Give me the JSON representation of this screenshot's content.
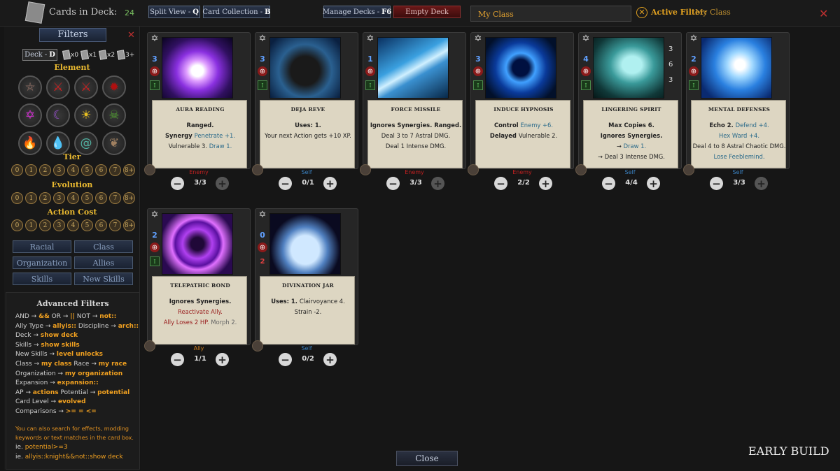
{
  "header": {
    "cards_in_deck_label": "Cards in Deck:",
    "cards_in_deck_count": "24",
    "split_view": {
      "label": "Split View -",
      "key": "Q"
    },
    "card_collection": {
      "label": "Card Collection -",
      "key": "B"
    },
    "manage_decks": {
      "label": "Manage Decks -",
      "key": "F6"
    },
    "empty_deck": "Empty Deck",
    "search_value": "My Class",
    "active_filter_label": "Active Filter:",
    "active_filter_value": "My Class"
  },
  "sidebar": {
    "filters_title": "Filters",
    "deck_button": {
      "label": "Deck -",
      "key": "D"
    },
    "copies": [
      "x0",
      "x1",
      "x2",
      "3+"
    ],
    "element_title": "Element",
    "elements": [
      {
        "icon": "pentagram-icon",
        "color": "#8a6a60"
      },
      {
        "icon": "crossed-swords-icon",
        "color": "#cc2020"
      },
      {
        "icon": "crossed-swords-blood-icon",
        "color": "#cc2020"
      },
      {
        "icon": "blood-splat-icon",
        "color": "#b01010"
      },
      {
        "icon": "hexagram-icon",
        "color": "#d030d0"
      },
      {
        "icon": "crescent-moon-icon",
        "color": "#9a50d0"
      },
      {
        "icon": "sun-icon",
        "color": "#e8c020"
      },
      {
        "icon": "skull-icon",
        "color": "#50a030"
      },
      {
        "icon": "flame-icon",
        "color": "#e06010"
      },
      {
        "icon": "water-drop-icon",
        "color": "#2060d0"
      },
      {
        "icon": "wind-swirl-icon",
        "color": "#50b0a0"
      },
      {
        "icon": "leaf-icon",
        "color": "#a08060"
      }
    ],
    "tier_title": "Tier",
    "evolution_title": "Evolution",
    "action_cost_title": "Action Cost",
    "levels": [
      "0",
      "1",
      "2",
      "3",
      "4",
      "5",
      "6",
      "7",
      "8+"
    ],
    "category_buttons": [
      "Racial",
      "Class",
      "Organization",
      "Allies",
      "Skills",
      "New Skills"
    ]
  },
  "advanced": {
    "title": "Advanced Filters",
    "lines": [
      [
        {
          "t": "AND → "
        },
        {
          "t": "&&",
          "k": true
        },
        {
          "t": "   OR → "
        },
        {
          "t": "||",
          "k": true
        },
        {
          "t": "   NOT → "
        },
        {
          "t": "not::",
          "k": true
        }
      ],
      [
        {
          "t": "Ally Type → "
        },
        {
          "t": "allyis::",
          "k": true
        },
        {
          "t": "   Discipline → "
        },
        {
          "t": "arch::",
          "k": true
        }
      ],
      [
        {
          "t": "Deck → "
        },
        {
          "t": "show deck",
          "k": true
        }
      ],
      [
        {
          "t": "Skills → "
        },
        {
          "t": "show skills",
          "k": true
        }
      ],
      [
        {
          "t": "New Skills → "
        },
        {
          "t": "level unlocks",
          "k": true
        }
      ],
      [
        {
          "t": "Class → "
        },
        {
          "t": "my class",
          "k": true
        },
        {
          "t": "   Race → "
        },
        {
          "t": "my race",
          "k": true
        }
      ],
      [
        {
          "t": "Organization → "
        },
        {
          "t": "my organization",
          "k": true
        }
      ],
      [
        {
          "t": "Expansion → "
        },
        {
          "t": "expansion::",
          "k": true
        }
      ],
      [
        {
          "t": "AP → "
        },
        {
          "t": "actions",
          "k": true
        },
        {
          "t": "   Potential → "
        },
        {
          "t": "potential",
          "k": true
        }
      ],
      [
        {
          "t": "Card Level → "
        },
        {
          "t": "evolved",
          "k": true
        }
      ],
      [
        {
          "t": "Comparisons → "
        },
        {
          "t": ">=   =   <=",
          "k": true
        }
      ]
    ],
    "note1": "You can also search for effects, modding",
    "note2": "keywords or text matches in the card box.",
    "ex1_prefix": "ie. ",
    "ex1": "potential>=3",
    "ex2_prefix": "ie. ",
    "ex2": "allyis::knight&&not::show deck"
  },
  "cards": [
    {
      "name": "Aura Reading",
      "cost": "3",
      "art": "aura",
      "target": "Enemy",
      "target_color": "#c02020",
      "count": "3/3",
      "plus_disabled": true,
      "lines": [
        [
          {
            "t": "Ranged.",
            "b": true
          }
        ],
        [
          {
            "t": "Synergy ",
            "b": true
          },
          {
            "t": "Penetrate +1.",
            "c": "blu"
          }
        ],
        [
          {
            "t": "Vulnerable 3. "
          },
          {
            "t": "Draw 1.",
            "c": "blu"
          }
        ]
      ]
    },
    {
      "name": "Deja Reve",
      "cost": "3",
      "art": "cat",
      "target": "Self",
      "target_color": "#3a80c0",
      "count": "0/1",
      "plus_disabled": false,
      "lines": [
        [
          {
            "t": "Uses: 1.",
            "b": true
          }
        ],
        [
          {
            "t": "Your next Action gets +10 XP."
          }
        ]
      ]
    },
    {
      "name": "Force Missile",
      "cost": "1",
      "art": "missile",
      "target": "Enemy",
      "target_color": "#c02020",
      "count": "3/3",
      "plus_disabled": true,
      "lines": [
        [
          {
            "t": "Ignores Synergies. Ranged.",
            "b": true
          }
        ],
        [
          {
            "t": "Deal 3 to 7 Astral DMG."
          }
        ],
        [
          {
            "t": "Deal 1 Intense DMG."
          }
        ]
      ]
    },
    {
      "name": "Induce Hypnosis",
      "cost": "3",
      "art": "vortex",
      "target": "Enemy",
      "target_color": "#c02020",
      "count": "2/2",
      "plus_disabled": false,
      "lines": [
        [
          {
            "t": "Control ",
            "b": true
          },
          {
            "t": "Enemy +6.",
            "c": "blu"
          }
        ],
        [
          {
            "t": "Delayed ",
            "b": true
          },
          {
            "t": "Vulnerable 2."
          }
        ]
      ]
    },
    {
      "name": "Lingering Spirit",
      "cost": "4",
      "art": "spirit",
      "target": "Self",
      "target_color": "#3a80c0",
      "count": "4/4",
      "plus_disabled": false,
      "side_stats": [
        "3",
        "6",
        "3"
      ],
      "lines": [
        [
          {
            "t": "Max Copies 6.",
            "b": true
          }
        ],
        [
          {
            "t": "Ignores Synergies.",
            "b": true
          }
        ],
        [
          {
            "t": "→ "
          },
          {
            "t": "Draw 1.",
            "c": "blu"
          }
        ],
        [
          {
            "t": "→ Deal 3 Intense DMG."
          }
        ]
      ]
    },
    {
      "name": "Mental Defenses",
      "cost": "2",
      "art": "heart",
      "target": "Self",
      "target_color": "#3a80c0",
      "count": "3/3",
      "plus_disabled": true,
      "lines": [
        [
          {
            "t": "Echo 2. ",
            "b": true
          },
          {
            "t": "Defend +4.",
            "c": "blu"
          }
        ],
        [
          {
            "t": "Hex Ward +4.",
            "c": "blu"
          }
        ],
        [
          {
            "t": "Deal 4 to 8 Astral Chaotic DMG."
          }
        ],
        [
          {
            "t": "Lose Feeblemind.",
            "c": "blu"
          }
        ]
      ]
    },
    {
      "name": "Telepathic Bond",
      "cost": "2",
      "art": "orb",
      "target": "Ally",
      "target_color": "#d08020",
      "count": "1/1",
      "plus_disabled": false,
      "lines": [
        [
          {
            "t": "Ignores Synergies.",
            "b": true
          }
        ],
        [
          {
            "t": "Reactivate Ally.",
            "c": "red"
          }
        ],
        [
          {
            "t": "Ally Loses 2 HP. ",
            "c": "red"
          },
          {
            "t": "Morph 2.",
            "c": "gry"
          }
        ]
      ]
    },
    {
      "name": "Divination Jar",
      "cost": "0",
      "art": "jar",
      "target": "Self",
      "target_color": "#3a80c0",
      "count": "0/2",
      "plus_disabled": false,
      "health": "2",
      "lines": [
        [
          {
            "t": "Uses: 1. ",
            "b": true
          },
          {
            "t": "Clairvoyance 4."
          }
        ],
        [
          {
            "t": "Strain -2."
          }
        ]
      ]
    }
  ],
  "footer": {
    "close": "Close",
    "build": "EARLY BUILD"
  }
}
